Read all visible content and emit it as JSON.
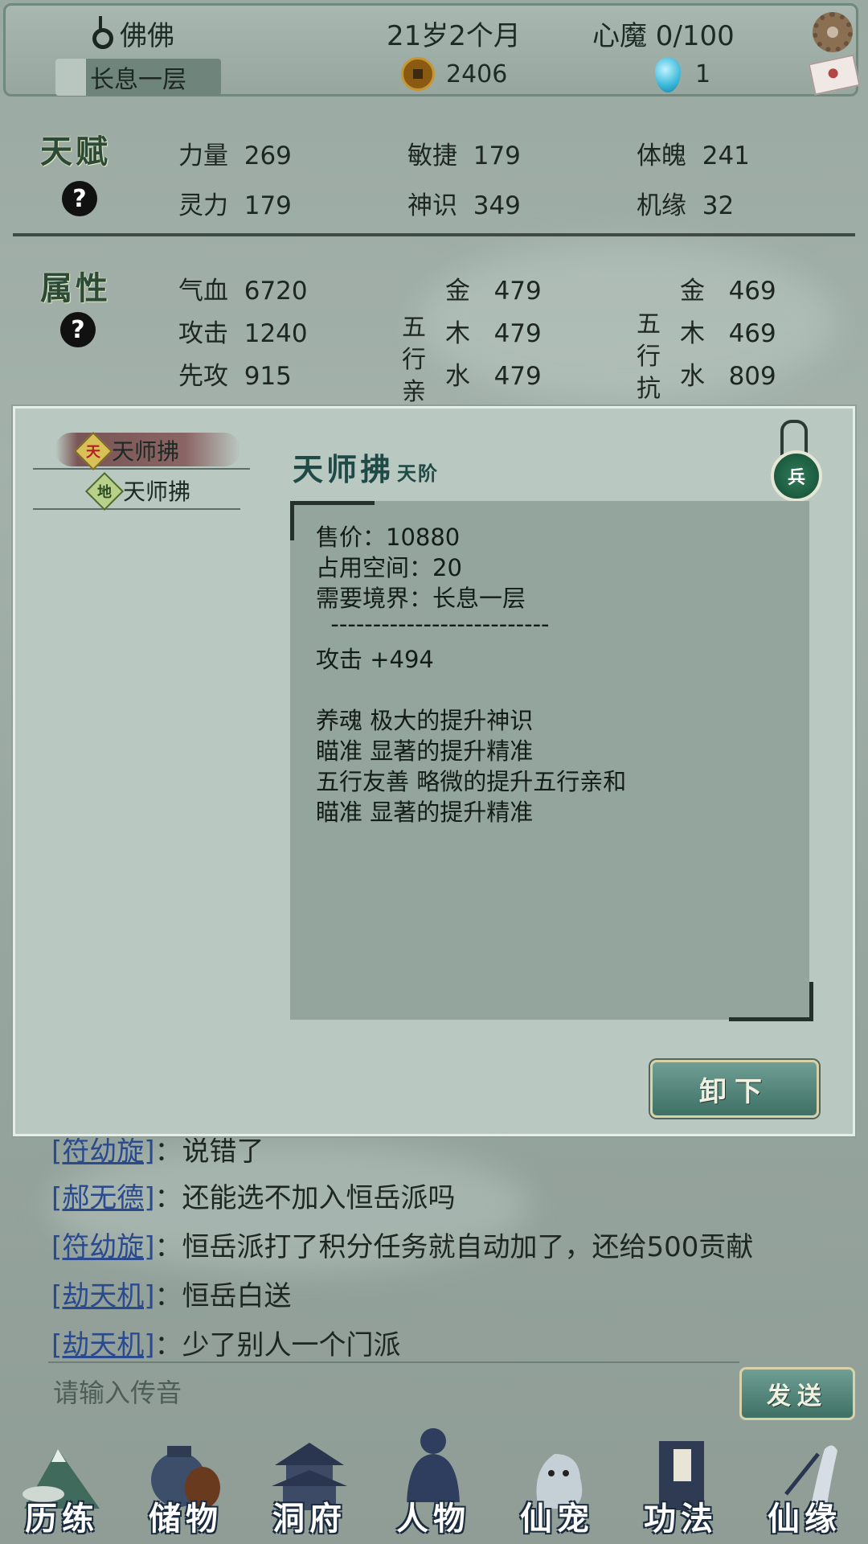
{
  "header": {
    "player_name": "佛佛",
    "realm": "长息一层",
    "age": "21岁2个月",
    "heart_demon": "心魔  0/100",
    "coins": "2406",
    "gems": "1"
  },
  "talent": {
    "title": "天赋",
    "help": "?",
    "stats": [
      {
        "label": "力量",
        "value": "269"
      },
      {
        "label": "敏捷",
        "value": "179"
      },
      {
        "label": "体魄",
        "value": "241"
      },
      {
        "label": "灵力",
        "value": "179"
      },
      {
        "label": "神识",
        "value": "349"
      },
      {
        "label": "机缘",
        "value": "32"
      }
    ]
  },
  "attributes": {
    "title": "属性",
    "help": "?",
    "stats": [
      {
        "label": "气血",
        "value": "6720"
      },
      {
        "label": "攻击",
        "value": "1240"
      },
      {
        "label": "先攻",
        "value": "915"
      }
    ],
    "affinity_label": [
      "五",
      "行",
      "亲"
    ],
    "affinity": [
      {
        "label": "金",
        "value": "479"
      },
      {
        "label": "木",
        "value": "479"
      },
      {
        "label": "水",
        "value": "479"
      }
    ],
    "resist_label": [
      "五",
      "行",
      "抗"
    ],
    "resist": [
      {
        "label": "金",
        "value": "469"
      },
      {
        "label": "木",
        "value": "469"
      },
      {
        "label": "水",
        "value": "809"
      }
    ]
  },
  "modal": {
    "tabs": [
      {
        "grade": "天",
        "name": "天师拂"
      },
      {
        "grade": "地",
        "name": "天师拂"
      }
    ],
    "item_name": "天师拂",
    "item_grade": "天阶",
    "type_badge": "兵",
    "lines": [
      "售价：10880",
      "占用空间：20",
      "需要境界：长息一层",
      "  --------------------------",
      "攻击 +494",
      "",
      "养魂 极大的提升神识",
      "瞄准 显著的提升精准",
      "五行友善 略微的提升五行亲和",
      "瞄准 显著的提升精准"
    ],
    "unequip_label": "卸下"
  },
  "chat": {
    "messages": [
      {
        "name": "[符幼旋]",
        "text": "：说错了"
      },
      {
        "name": "[郝无德]",
        "text": "：还能选不加入恒岳派吗"
      },
      {
        "name": "[符幼旋]",
        "text": "：恒岳派打了积分任务就自动加了，还给500贡献"
      },
      {
        "name": "[劫天机]",
        "text": "：恒岳白送"
      },
      {
        "name": "[劫天机]",
        "text": "：少了别人一个门派"
      }
    ],
    "input_placeholder": "请输入传音",
    "send_label": "发送"
  },
  "nav": {
    "items": [
      {
        "label": "历练",
        "icon": "mountain-icon"
      },
      {
        "label": "储物",
        "icon": "bag-icon"
      },
      {
        "label": "洞府",
        "icon": "pagoda-icon"
      },
      {
        "label": "人物",
        "icon": "character-icon"
      },
      {
        "label": "仙宠",
        "icon": "pet-icon"
      },
      {
        "label": "功法",
        "icon": "book-icon"
      },
      {
        "label": "仙缘",
        "icon": "crane-icon"
      }
    ]
  }
}
